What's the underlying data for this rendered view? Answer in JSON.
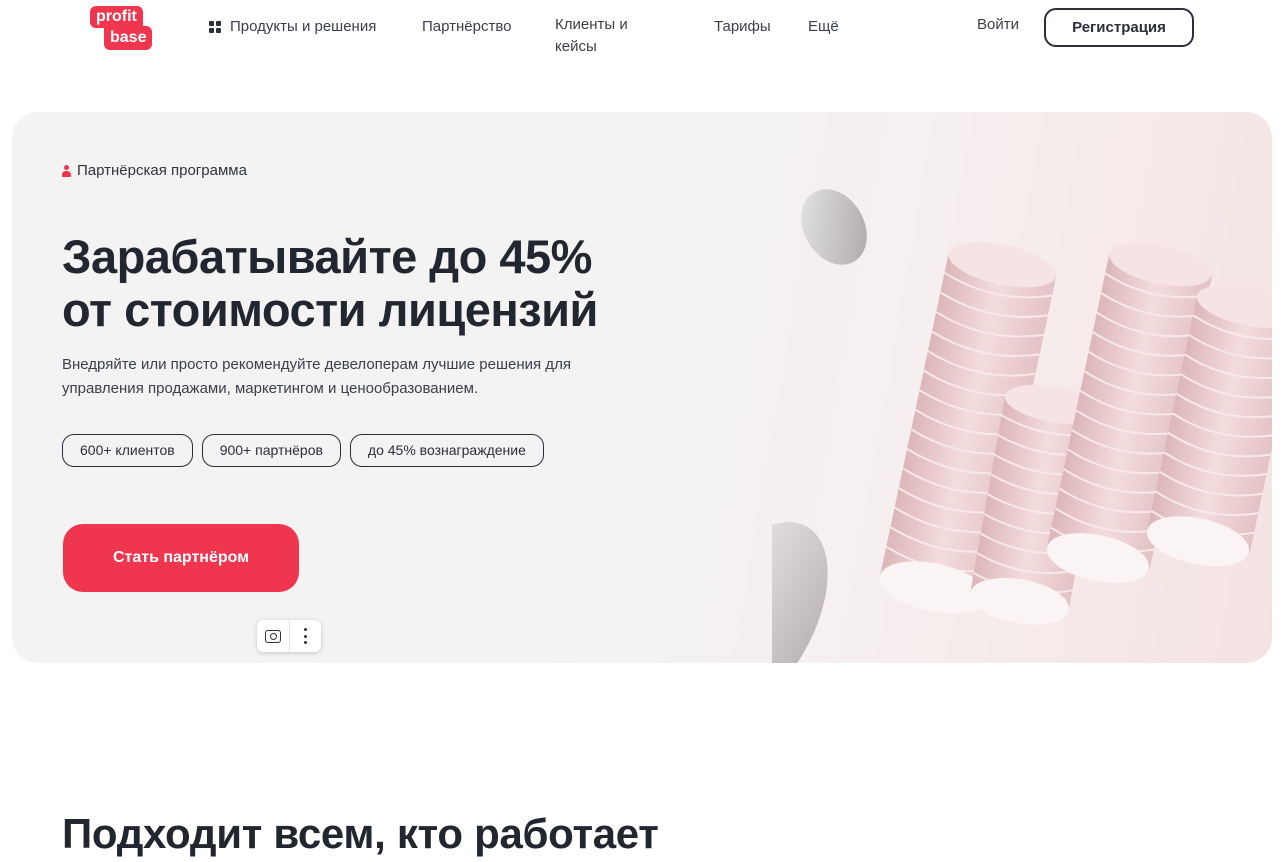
{
  "header": {
    "logo_top": "profit",
    "logo_bottom": "base",
    "nav": {
      "products": "Продукты и решения",
      "partnership": "Партнёрство",
      "clients": "Клиенты и кейсы",
      "tariffs": "Тарифы",
      "more": "Ещё"
    },
    "login": "Войти",
    "register": "Регистрация"
  },
  "hero": {
    "badge": "Партнёрская программа",
    "title_line1": "Зарабатывайте до 45%",
    "title_line2": "от стоимости лицензий",
    "subtitle": "Внедряйте или просто рекомендуйте девелоперам лучшие решения для управления продажами, маркетингом и ценообразованием.",
    "chips": [
      "600+ клиентов",
      "900+ партнёров",
      "до 45% вознаграждение"
    ],
    "cta": "Стать партнёром"
  },
  "section": {
    "title": "Подходит всем, кто работает"
  },
  "colors": {
    "accent": "#f0354f",
    "text": "#22262f",
    "hero_bg": "#f3f3f4"
  },
  "icons": [
    "grid-icon",
    "person-icon",
    "camera-icon",
    "more-dots-icon"
  ]
}
